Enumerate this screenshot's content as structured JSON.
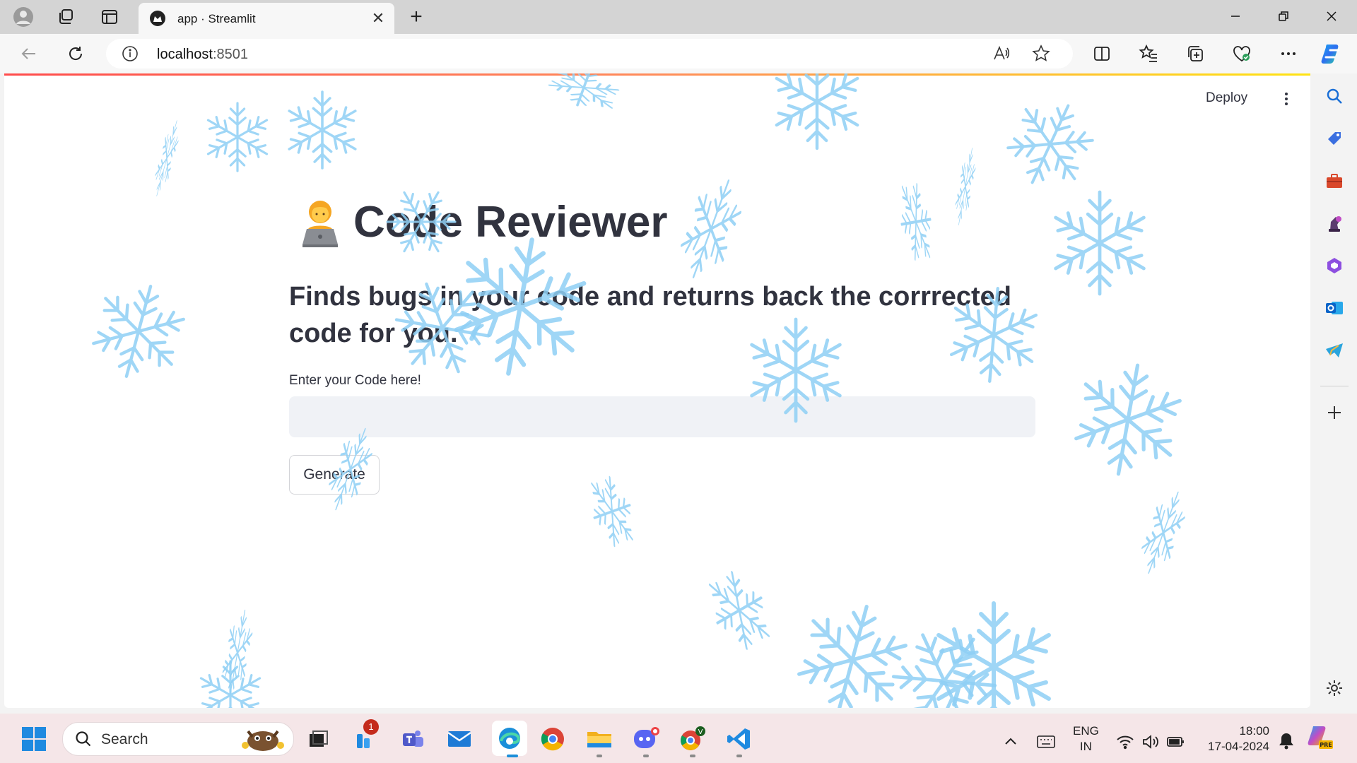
{
  "browser": {
    "tab_title": "app · Streamlit",
    "url_host": "localhost",
    "url_port": ":8501"
  },
  "app": {
    "deploy_label": "Deploy",
    "title": "Code Reviewer",
    "subtitle": "Finds bugs in your code and returns back the corrrected code for you.",
    "input_label": "Enter your Code here!",
    "input_value": "",
    "button_label": "Generate"
  },
  "taskbar": {
    "search_placeholder": "Search",
    "badge_count": "1",
    "lang_line1": "ENG",
    "lang_line2": "IN",
    "time": "18:00",
    "date": "17-04-2024"
  },
  "colors": {
    "accent_bar": [
      "#ff4b4b",
      "#ffe312"
    ],
    "text": "#31333f",
    "input_bg": "#f0f2f6",
    "snowflake": "#8fd0f5",
    "taskbar_bg": "#f5e6e8"
  },
  "icons": [
    "profile-icon",
    "workspaces-icon",
    "tab-actions-icon",
    "streamlit-favicon",
    "back-icon",
    "refresh-icon",
    "info-icon",
    "read-aloud-icon",
    "favorite-star-icon",
    "split-screen-icon",
    "favorites-icon",
    "collections-icon",
    "browser-essentials-icon",
    "more-icon",
    "copilot-icon",
    "search-icon",
    "shopping-icon",
    "tools-icon",
    "games-icon",
    "office-icon",
    "outlook-icon",
    "telegram-icon",
    "add-icon",
    "settings-icon",
    "windows-start-icon",
    "file-explorer-icon",
    "teams-icon",
    "mail-icon",
    "edge-icon",
    "chrome-icon",
    "folder-icon",
    "discord-icon",
    "vscode-icon",
    "wifi-icon",
    "volume-icon",
    "battery-icon",
    "notification-bell-icon"
  ]
}
